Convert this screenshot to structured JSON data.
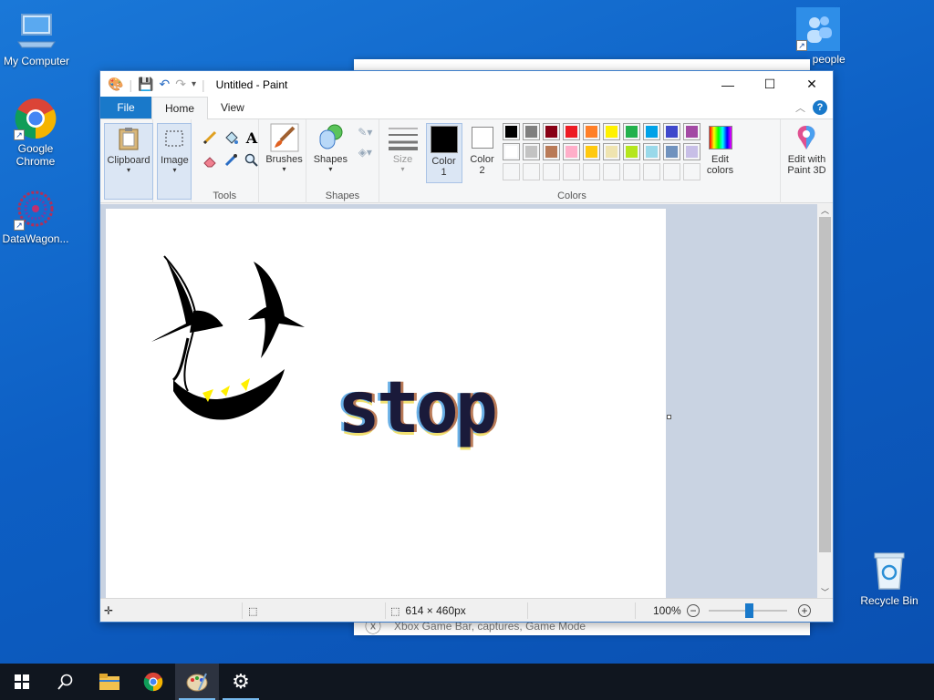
{
  "desktop": {
    "icons": [
      {
        "label": "My Computer",
        "icon": "monitor-icon"
      },
      {
        "label": "Google Chrome",
        "icon": "chrome-icon"
      },
      {
        "label": "DataWagon...",
        "icon": "datawagon-icon"
      },
      {
        "label": "... people",
        "icon": "people-icon"
      },
      {
        "label": "Recycle Bin",
        "icon": "recycle-bin-icon"
      }
    ]
  },
  "background_window": {
    "footer_text": "Xbox Game Bar, captures, Game Mode"
  },
  "paint": {
    "title": "Untitled - Paint",
    "tabs": [
      {
        "label": "File"
      },
      {
        "label": "Home"
      },
      {
        "label": "View"
      }
    ],
    "groups": {
      "clipboard": "Clipboard",
      "image": "Image",
      "tools": "Tools",
      "brushes": "Brushes",
      "shapes": "Shapes",
      "shapes_group": "Shapes",
      "size": "Size",
      "color1": "Color\n1",
      "color2": "Color\n2",
      "colors": "Colors",
      "edit_colors": "Edit\ncolors",
      "edit_3d": "Edit with\nPaint 3D"
    },
    "palette_row1": [
      "#000000",
      "#7f7f7f",
      "#880015",
      "#ed1c24",
      "#ff7f27",
      "#fff200",
      "#22b14c",
      "#00a2e8",
      "#3f48cc",
      "#a349a4"
    ],
    "palette_row2": [
      "#ffffff",
      "#c3c3c3",
      "#b97a57",
      "#ffaec9",
      "#ffc90e",
      "#efe4b0",
      "#b5e61d",
      "#99d9ea",
      "#7092be",
      "#c8bfe7"
    ],
    "color1": "#000000",
    "color2": "#ffffff",
    "canvas_text": "stop",
    "status": {
      "canvas_size": "614 × 460px",
      "zoom": "100%"
    }
  },
  "taskbar": {
    "items": [
      "windows-start-icon",
      "search-icon",
      "file-explorer-icon",
      "chrome-icon",
      "paint-icon",
      "settings-icon"
    ]
  }
}
